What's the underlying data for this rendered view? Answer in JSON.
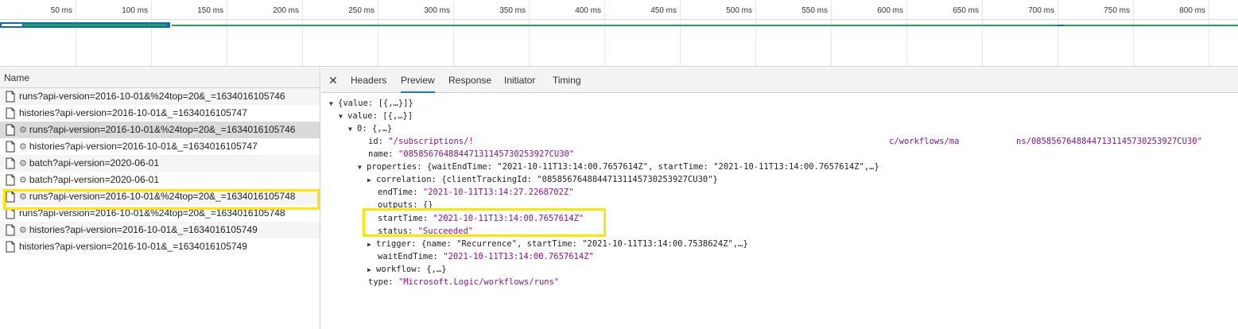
{
  "timeline": {
    "ticks": [
      "50 ms",
      "100 ms",
      "150 ms",
      "200 ms",
      "250 ms",
      "300 ms",
      "350 ms",
      "400 ms",
      "450 ms",
      "500 ms",
      "550 ms",
      "600 ms",
      "650 ms",
      "700 ms",
      "750 ms",
      "800 ms"
    ],
    "colors": {
      "bar_green": "#1fa35c",
      "bar_blue": "#1565c0",
      "bar_light": "#ffffff"
    }
  },
  "network": {
    "name_header": "Name",
    "requests": [
      "runs?api-version=2016-10-01&%24top=20&_=1634016105746",
      "histories?api-version=2016-10-01&_=1634016105747",
      "runs?api-version=2016-10-01&%24top=20&_=1634016105746",
      "histories?api-version=2016-10-01&_=1634016105747",
      "batch?api-version=2020-06-01",
      "batch?api-version=2020-06-01",
      "runs?api-version=2016-10-01&%24top=20&_=1634016105748",
      "runs?api-version=2016-10-01&%24top=20&_=1634016105748",
      "histories?api-version=2016-10-01&_=1634016105749",
      "histories?api-version=2016-10-01&_=1634016105749"
    ],
    "selected_index": 2
  },
  "details": {
    "close_label": "✕",
    "tabs": [
      "Headers",
      "Preview",
      "Response",
      "Initiator",
      "Timing"
    ],
    "active_tab": "Preview"
  },
  "preview": {
    "l1": "{value: [{,…}]}",
    "l2": "value: [{,…}]",
    "l3": "0: {,…}",
    "id_key": "id:",
    "id_a": "\"/subscriptions/!",
    "id_b": "c/workflows/ma",
    "id_c": "ns/08585676488447131145730253927CU30\"",
    "name_key": "name:",
    "name_val": "\"08585676488447131145730253927CU30\"",
    "props_key": "properties:",
    "props_val": "{waitEndTime: \"2021-10-11T13:14:00.7657614Z\", startTime: \"2021-10-11T13:14:00.7657614Z\",…}",
    "corr_key": "correlation:",
    "corr_val": "{clientTrackingId: \"08585676488447131145730253927CU30\"}",
    "end_key": "endTime:",
    "end_val": "\"2021-10-11T13:14:27.2268702Z\"",
    "outputs_key": "outputs:",
    "outputs_val": "{}",
    "start_key": "startTime:",
    "start_val": "\"2021-10-11T13:14:00.7657614Z\"",
    "status_key": "status:",
    "status_val": "\"Succeeded\"",
    "trigger_key": "trigger:",
    "trigger_val": "{name: \"Recurrence\", startTime: \"2021-10-11T13:14:00.7538624Z\",…}",
    "wait_key": "waitEndTime:",
    "wait_val": "\"2021-10-11T13:14:00.7657614Z\"",
    "workflow_key": "workflow:",
    "workflow_val": "{,…}",
    "type_key": "type:",
    "type_val": "\"Microsoft.Logic/workflows/runs\""
  }
}
